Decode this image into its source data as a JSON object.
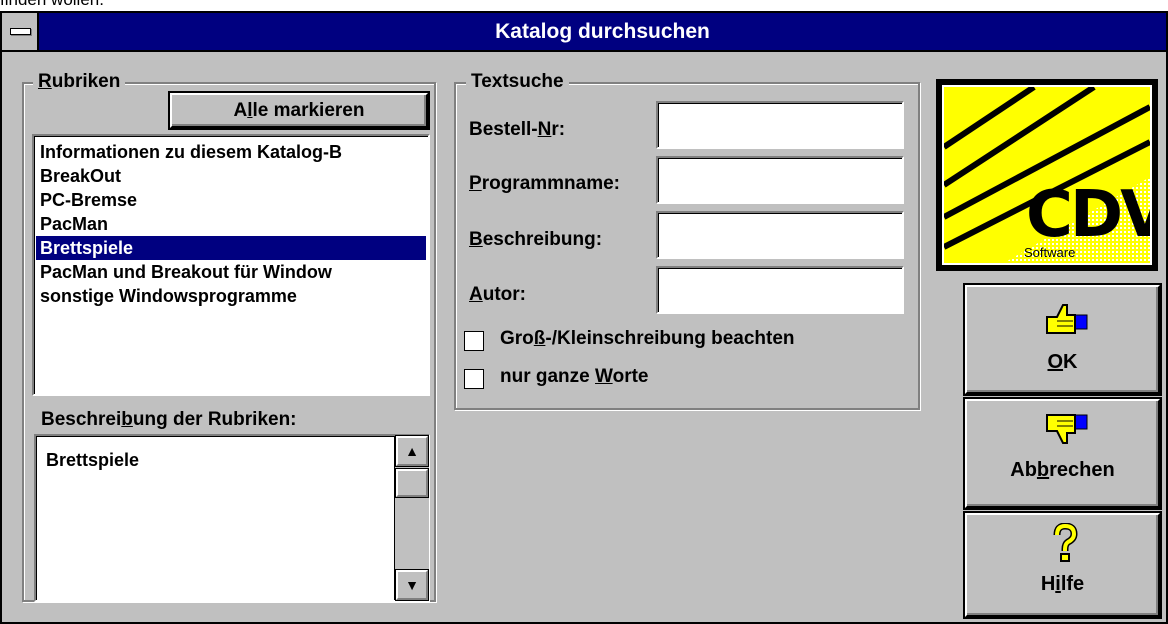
{
  "top_cropped_text": "finden wollen.",
  "window": {
    "title": "Katalog durchsuchen"
  },
  "rubriken": {
    "group_label_first": "R",
    "group_label_rest": "ubriken",
    "select_all_pre": "A",
    "select_all_ul": "l",
    "select_all_post": "le markieren",
    "items": [
      "Informationen zu diesem Katalog-B",
      "BreakOut",
      "PC-Bremse",
      "PacMan",
      "Brettspiele",
      "PacMan und Breakout für Window",
      "sonstige Windowsprogramme"
    ],
    "selected_index": 4,
    "desc_label_pre": "Beschrei",
    "desc_label_ul": "b",
    "desc_label_post": "ung der Rubriken:",
    "desc_text": "Brettspiele"
  },
  "textsuche": {
    "group_label": "Textsuche",
    "fields": {
      "bestell_pre": "Bestell-",
      "bestell_ul": "N",
      "bestell_post": "r:",
      "programm_ul": "P",
      "programm_post": "rogrammname:",
      "beschr_ul": "B",
      "beschr_post": "eschreibung:",
      "autor_ul": "A",
      "autor_post": "utor:",
      "values": {
        "bestell": "",
        "programm": "",
        "beschreibung": "",
        "autor": ""
      }
    },
    "case_sensitive_pre": "Gro",
    "case_sensitive_ul": "ß",
    "case_sensitive_post": "-/Kleinschreibung beachten",
    "case_sensitive_checked": false,
    "whole_words_pre": "nur ganze ",
    "whole_words_ul": "W",
    "whole_words_post": "orte",
    "whole_words_checked": false
  },
  "logo": {
    "brand": "CDV",
    "sub": "Software"
  },
  "buttons": {
    "ok_ul": "O",
    "ok_post": "K",
    "cancel_pre": "Ab",
    "cancel_ul": "b",
    "cancel_post": "rechen",
    "help_pre": "H",
    "help_ul": "i",
    "help_post": "lfe"
  },
  "colors": {
    "face": "#c0c0c0",
    "title": "#000080",
    "highlight": "#000080",
    "logo_yellow": "#ffff00"
  }
}
